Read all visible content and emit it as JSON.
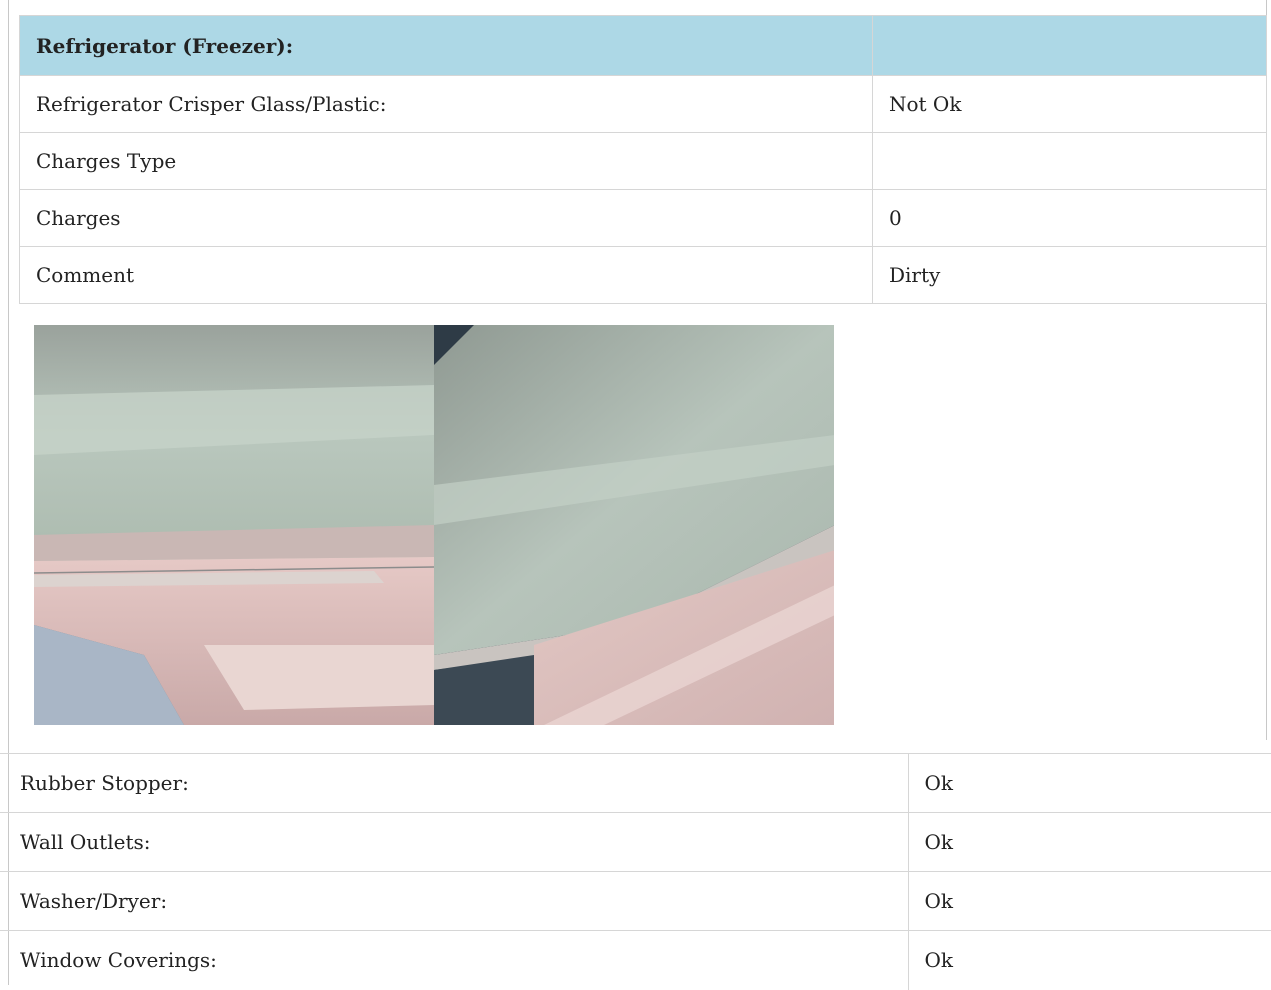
{
  "section": {
    "title": "Refrigerator (Freezer):",
    "title_value": "",
    "rows": [
      {
        "label": "Refrigerator Crisper Glass/Plastic:",
        "value": "Not Ok"
      },
      {
        "label": "Charges Type",
        "value": ""
      },
      {
        "label": "Charges",
        "value": "0"
      },
      {
        "label": "Comment",
        "value": "Dirty"
      }
    ],
    "photos": [
      {
        "icon": "photo-crisper-left"
      },
      {
        "icon": "photo-crisper-right"
      }
    ]
  },
  "summary": {
    "rows": [
      {
        "label": "Rubber Stopper:",
        "value": "Ok"
      },
      {
        "label": "Wall Outlets:",
        "value": "Ok"
      },
      {
        "label": "Washer/Dryer:",
        "value": "Ok"
      },
      {
        "label": "Window Coverings:",
        "value": "Ok"
      }
    ]
  },
  "colors": {
    "header_bg": "#add8e6",
    "border": "#d6d6d6"
  }
}
